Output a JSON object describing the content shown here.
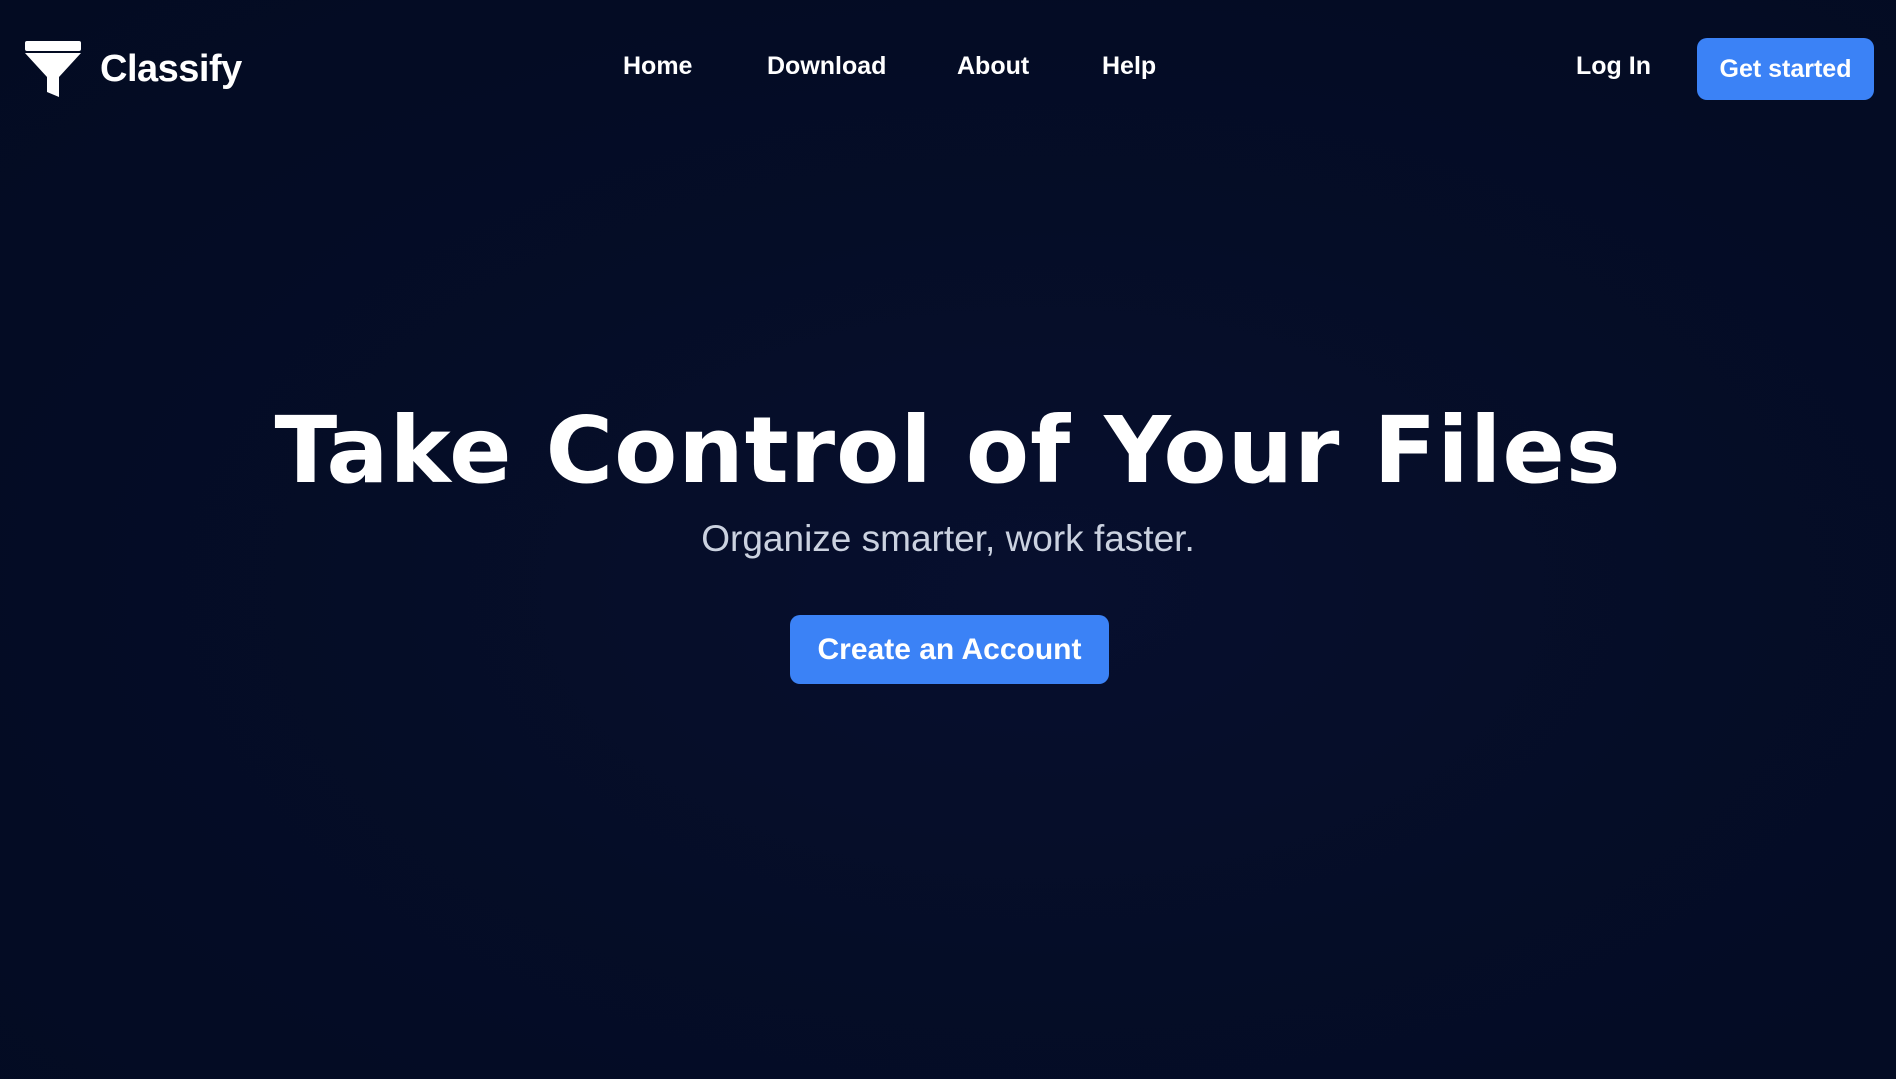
{
  "brand": {
    "name": "Classify",
    "icon": "funnel-icon"
  },
  "nav": {
    "links": [
      {
        "label": "Home"
      },
      {
        "label": "Download"
      },
      {
        "label": "About"
      },
      {
        "label": "Help"
      }
    ],
    "login_label": "Log In",
    "get_started_label": "Get started"
  },
  "hero": {
    "title": "Take Control of Your Files",
    "subtitle": "Organize smarter, work faster.",
    "cta_label": "Create an Account"
  },
  "colors": {
    "background": "#040d24",
    "accent": "#3b82f6",
    "text": "#ffffff",
    "subtext": "#cbd2e0"
  }
}
